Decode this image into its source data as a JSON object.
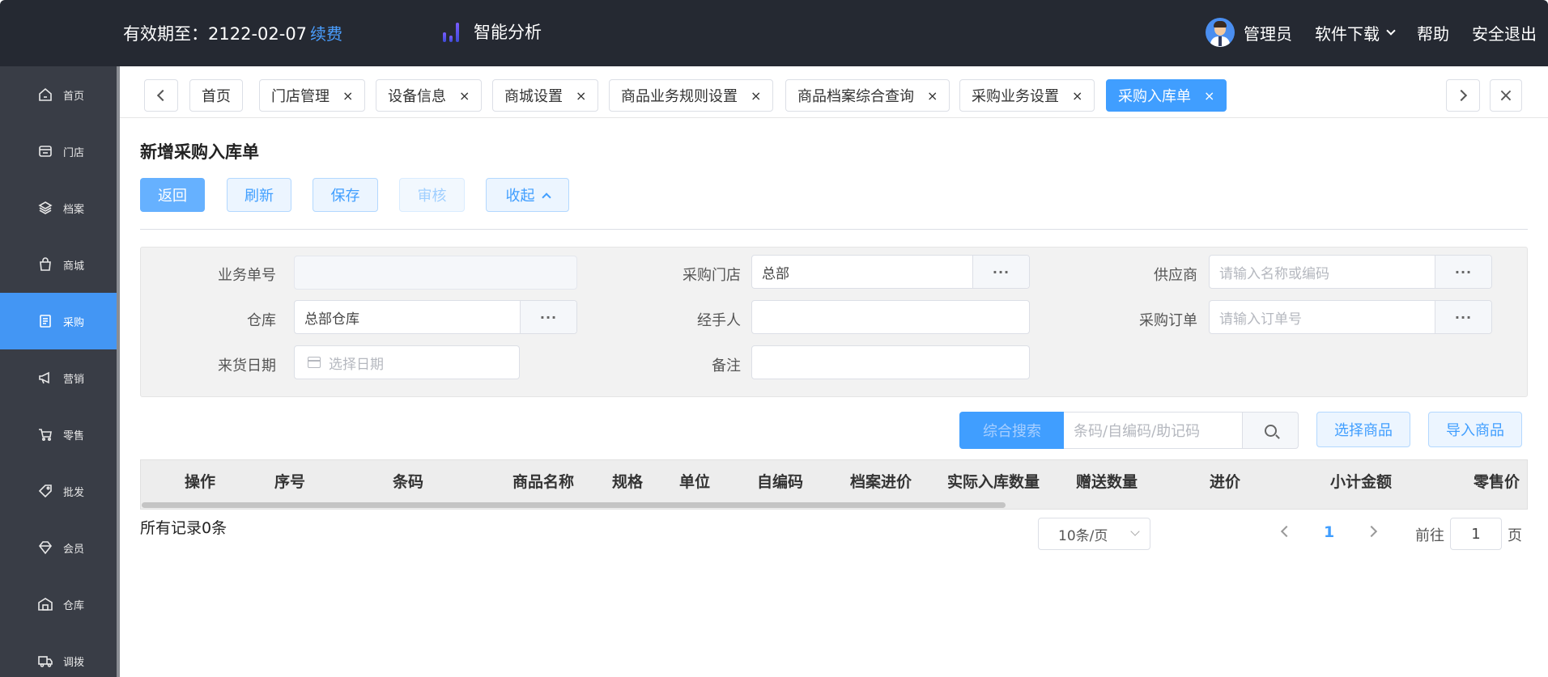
{
  "header": {
    "validity_label": "有效期至：",
    "validity_date": "2122-02-07",
    "renew_link": "续费",
    "brand": "智能分析",
    "user_name": "管理员",
    "download": "软件下载",
    "help": "帮助",
    "logout": "安全退出"
  },
  "sidebar": {
    "items": [
      {
        "label": "首页",
        "icon": "home-icon"
      },
      {
        "label": "门店",
        "icon": "store-icon"
      },
      {
        "label": "档案",
        "icon": "layers-icon"
      },
      {
        "label": "商城",
        "icon": "shopping-bag-icon"
      },
      {
        "label": "采购",
        "icon": "purchase-icon"
      },
      {
        "label": "营销",
        "icon": "megaphone-icon"
      },
      {
        "label": "零售",
        "icon": "cart-icon"
      },
      {
        "label": "批发",
        "icon": "tag-icon"
      },
      {
        "label": "会员",
        "icon": "diamond-icon"
      },
      {
        "label": "仓库",
        "icon": "warehouse-icon"
      },
      {
        "label": "调拨",
        "icon": "truck-icon"
      }
    ],
    "active_index": 4
  },
  "tabs": {
    "items": [
      {
        "label": "首页",
        "closable": false
      },
      {
        "label": "门店管理",
        "closable": true
      },
      {
        "label": "设备信息",
        "closable": true
      },
      {
        "label": "商城设置",
        "closable": true
      },
      {
        "label": "商品业务规则设置",
        "closable": true
      },
      {
        "label": "商品档案综合查询",
        "closable": true
      },
      {
        "label": "采购业务设置",
        "closable": true
      },
      {
        "label": "采购入库单",
        "closable": true
      }
    ],
    "close_glyph": "×"
  },
  "page": {
    "title": "新增采购入库单",
    "buttons": {
      "back": "返回",
      "refresh": "刷新",
      "save": "保存",
      "audit": "审核",
      "collapse": "收起"
    }
  },
  "form": {
    "order_no_label": "业务单号",
    "order_no_value": "",
    "store_label": "采购门店",
    "store_value": "总部",
    "supplier_label": "供应商",
    "supplier_placeholder": "请输入名称或编码",
    "warehouse_label": "仓库",
    "warehouse_value": "总部仓库",
    "handler_label": "经手人",
    "handler_value": "",
    "purchase_order_label": "采购订单",
    "purchase_order_placeholder": "请输入订单号",
    "arrival_date_label": "来货日期",
    "arrival_date_placeholder": "选择日期",
    "remark_label": "备注",
    "remark_value": "",
    "dots": "···"
  },
  "search": {
    "mode_button": "综合搜索",
    "placeholder": "条码/自编码/助记码",
    "select_goods": "选择商品",
    "import_goods": "导入商品"
  },
  "table": {
    "columns": [
      "操作",
      "序号",
      "条码",
      "商品名称",
      "规格",
      "单位",
      "自编码",
      "档案进价",
      "实际入库数量",
      "赠送数量",
      "进价",
      "小计金额",
      "零售价"
    ]
  },
  "pagination": {
    "total_text": "所有记录0条",
    "page_size": "10条/页",
    "current_page": "1",
    "goto_label": "前往",
    "goto_value": "1",
    "page_unit": "页"
  },
  "colors": {
    "accent": "#409eff",
    "topbar": "#252932",
    "sidebar": "#393d46",
    "sidebar_active": "#4396f4"
  }
}
